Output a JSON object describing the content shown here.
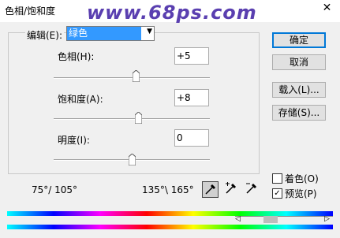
{
  "window": {
    "title": "色相/饱和度",
    "watermark": "www.68ps.com",
    "close_icon": "close-icon"
  },
  "edit": {
    "label": "编辑(E):",
    "selected": "绿色"
  },
  "hue": {
    "label": "色相(H):",
    "value": "+5",
    "slider_value": 5
  },
  "saturation": {
    "label": "饱和度(A):",
    "value": "+8",
    "slider_value": 8
  },
  "lightness": {
    "label": "明度(I):",
    "value": "0",
    "slider_value": 0
  },
  "range_left": "75°/ 105°",
  "range_right": "135°\\ 165°",
  "buttons": {
    "ok": "确定",
    "cancel": "取消",
    "load": "载入(L)...",
    "save": "存储(S)..."
  },
  "colorize": {
    "label": "着色(O)",
    "checked": false
  },
  "preview": {
    "label": "预览(P)",
    "checked": true,
    "check_mark": "✓"
  }
}
